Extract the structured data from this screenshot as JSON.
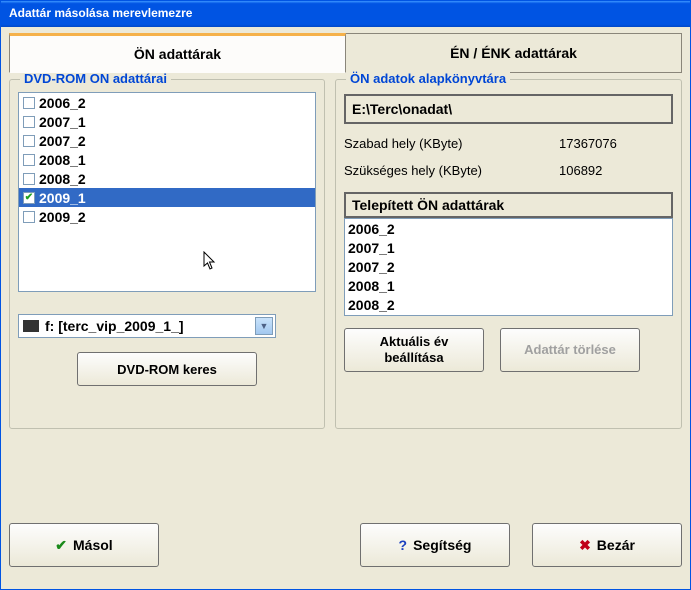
{
  "window": {
    "title": "Adattár másolása merevlemezre"
  },
  "tabs": {
    "on": {
      "label": "ÖN adattárak"
    },
    "en": {
      "label": "ÉN / ÉNK adattárak"
    }
  },
  "left_group": {
    "title": "DVD-ROM ÖN adattárai",
    "items": [
      {
        "label": "2006_2",
        "checked": false,
        "selected": false
      },
      {
        "label": "2007_1",
        "checked": false,
        "selected": false
      },
      {
        "label": "2007_2",
        "checked": false,
        "selected": false
      },
      {
        "label": "2008_1",
        "checked": false,
        "selected": false
      },
      {
        "label": "2008_2",
        "checked": false,
        "selected": false
      },
      {
        "label": "2009_1",
        "checked": true,
        "selected": true
      },
      {
        "label": "2009_2",
        "checked": false,
        "selected": false
      }
    ],
    "drive_combo": "f: [terc_vip_2009_1_]",
    "search_btn": "DVD-ROM keres"
  },
  "right_group": {
    "title": "ÖN adatok alapkönyvtára",
    "path": "E:\\Terc\\onadat\\",
    "free_label": "Szabad hely (KByte)",
    "free_value": "17367076",
    "need_label": "Szükséges hely (KByte)",
    "need_value": "106892",
    "installed_title": "Telepített ÖN adattárak",
    "installed": [
      "2006_2",
      "2007_1",
      "2007_2",
      "2008_1",
      "2008_2"
    ],
    "set_year_btn": "Aktuális év beállítása",
    "delete_btn": "Adattár törlése"
  },
  "bottom": {
    "copy": "Másol",
    "help": "Segítség",
    "close": "Bezár"
  }
}
